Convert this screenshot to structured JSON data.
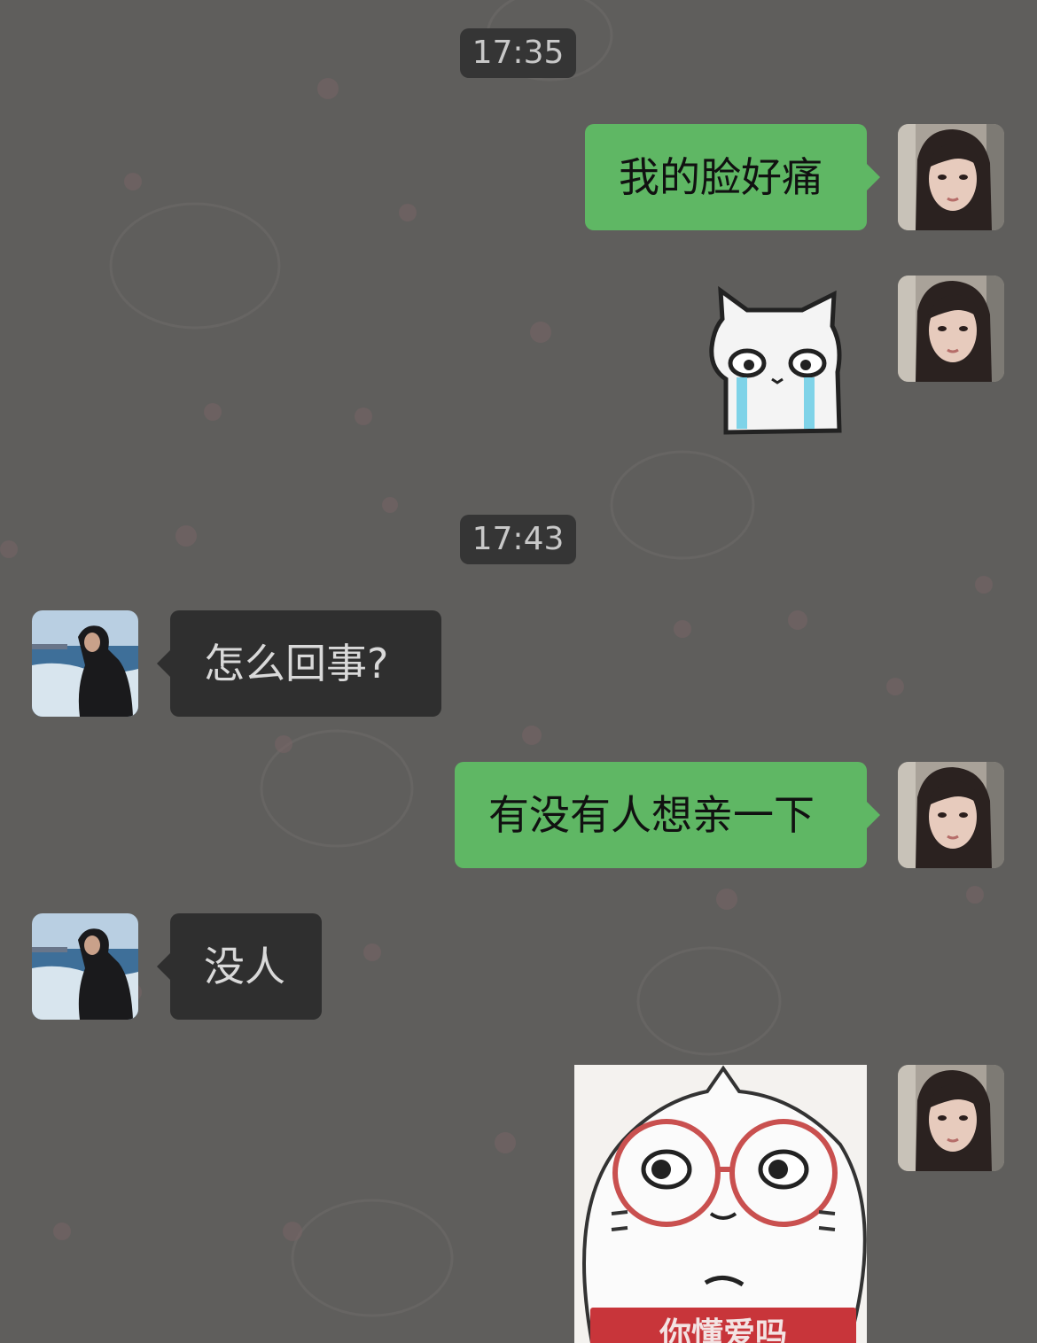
{
  "chat": {
    "timestamps": [
      "17:35",
      "17:43"
    ],
    "messages": [
      {
        "sender": "self",
        "type": "text",
        "text": "我的脸好痛"
      },
      {
        "sender": "self",
        "type": "sticker",
        "sticker": "crying-white-cat"
      },
      {
        "sender": "other",
        "type": "text",
        "text": "怎么回事?"
      },
      {
        "sender": "self",
        "type": "text",
        "text": "有没有人想亲一下"
      },
      {
        "sender": "other",
        "type": "text",
        "text": "没人"
      },
      {
        "sender": "self",
        "type": "sticker",
        "sticker": "glasses-cat",
        "caption": "你懂爱吗"
      }
    ]
  },
  "colors": {
    "background": "#5f5e5c",
    "self_bubble": "#5fb764",
    "other_bubble": "#2f2f2f",
    "timestamp_bg": "#353535"
  },
  "avatars": {
    "self": "girl-portrait-avatar",
    "other": "man-on-boat-avatar"
  }
}
